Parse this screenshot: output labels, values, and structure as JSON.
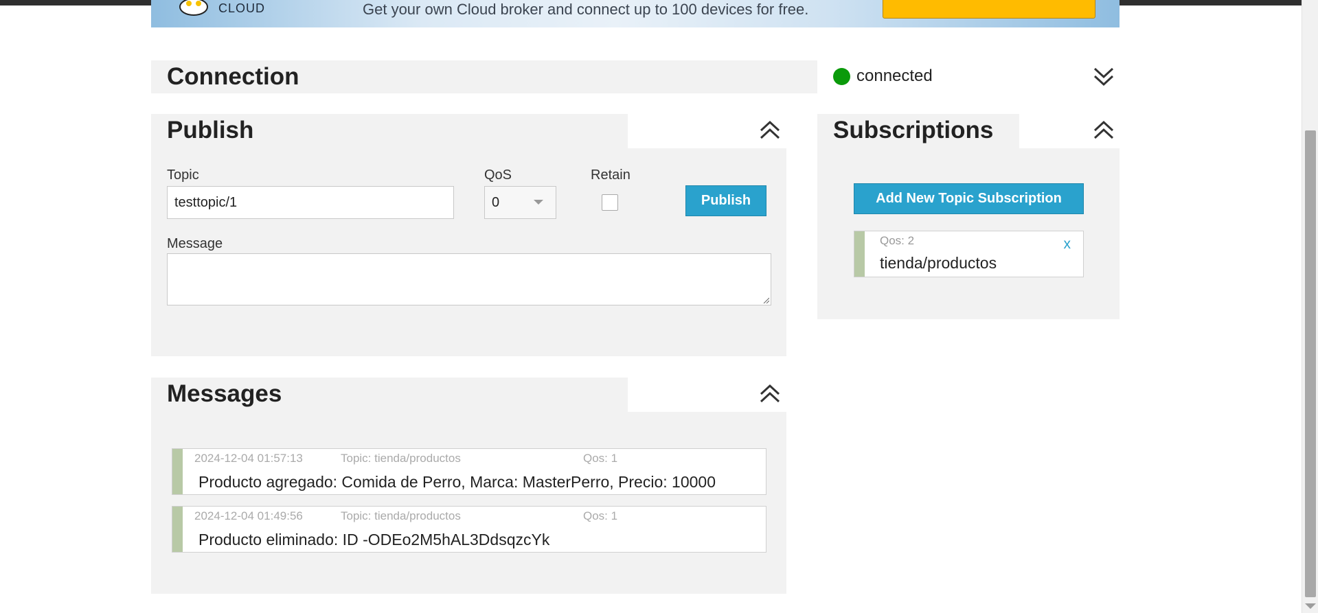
{
  "banner": {
    "logo_text": "CLOUD",
    "text": "Get your own Cloud broker and connect up to 100 devices for free."
  },
  "connection": {
    "title": "Connection",
    "status": "connected",
    "status_color": "#0a9a0a"
  },
  "publish": {
    "title": "Publish",
    "topic_label": "Topic",
    "topic_value": "testtopic/1",
    "qos_label": "QoS",
    "qos_value": "0",
    "retain_label": "Retain",
    "retain_checked": false,
    "button_label": "Publish",
    "message_label": "Message",
    "message_value": ""
  },
  "subscriptions": {
    "title": "Subscriptions",
    "add_button_label": "Add New Topic Subscription",
    "items": [
      {
        "qos": "Qos: 2",
        "topic": "tienda/productos",
        "remove_label": "x"
      }
    ]
  },
  "messages": {
    "title": "Messages",
    "items": [
      {
        "timestamp": "2024-12-04 01:57:13",
        "topic": "Topic: tienda/productos",
        "qos": "Qos: 1",
        "text": "Producto agregado: Comida de Perro, Marca: MasterPerro, Precio: 10000"
      },
      {
        "timestamp": "2024-12-04 01:49:56",
        "topic": "Topic: tienda/productos",
        "qos": "Qos: 1",
        "text": "Producto eliminado: ID -ODEo2M5hAL3DdsqzcYk"
      }
    ]
  },
  "colors": {
    "accent": "#2aa2cd",
    "panel_bg": "#f2f2f2",
    "message_bar": "#b8c9a6"
  }
}
